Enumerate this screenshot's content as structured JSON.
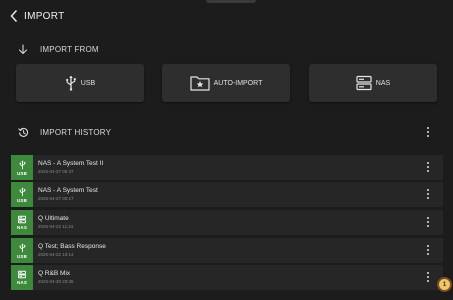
{
  "header": {
    "title": "IMPORT",
    "back_icon": "chevron-left-icon"
  },
  "import_from": {
    "label": "IMPORT FROM",
    "icon": "arrow-down-icon",
    "buttons": [
      {
        "label": "USB",
        "icon": "usb-icon"
      },
      {
        "label": "AUTO-IMPORT",
        "icon": "folder-star-icon"
      },
      {
        "label": "NAS",
        "icon": "nas-icon"
      }
    ]
  },
  "import_history": {
    "label": "IMPORT HISTORY",
    "icon": "history-icon",
    "items": [
      {
        "name": "NAS - A System Test II",
        "date": "2025-04-27 00:47",
        "source": "USB"
      },
      {
        "name": "NAS - A System Test",
        "date": "2025-04-27 00:17",
        "source": "USB"
      },
      {
        "name": "Q Ultimate",
        "date": "2025-04-22 11:24",
        "source": "NAS"
      },
      {
        "name": "Q Test; Bass Response",
        "date": "2025-04-22 10:14",
        "source": "USB"
      },
      {
        "name": "Q R&B Mix",
        "date": "2025-04-20 23:36",
        "source": "NAS"
      }
    ]
  },
  "badge": {
    "count": "1"
  },
  "colors": {
    "background": "#1c1c1c",
    "button": "#2e2e2e",
    "row": "#262626",
    "source_tile": "#3d8a3d",
    "badge": "#f1c56b"
  }
}
